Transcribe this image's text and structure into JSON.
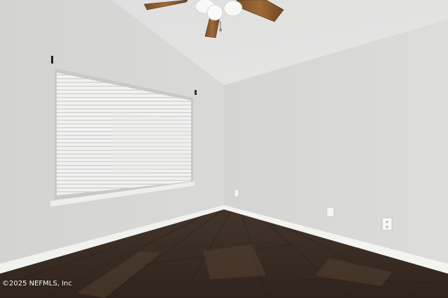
{
  "photo": {
    "subject": "empty room",
    "watermark": "©2025 NEFMLS, Inc"
  },
  "colors": {
    "left_wall": "#d7d7d5",
    "right_wall": "#dadad8",
    "ceiling": "#e3e3e1",
    "floor": "#3b2e24",
    "baseboard": "#f2f2f0",
    "fan_blade": "#8a5a2e"
  }
}
